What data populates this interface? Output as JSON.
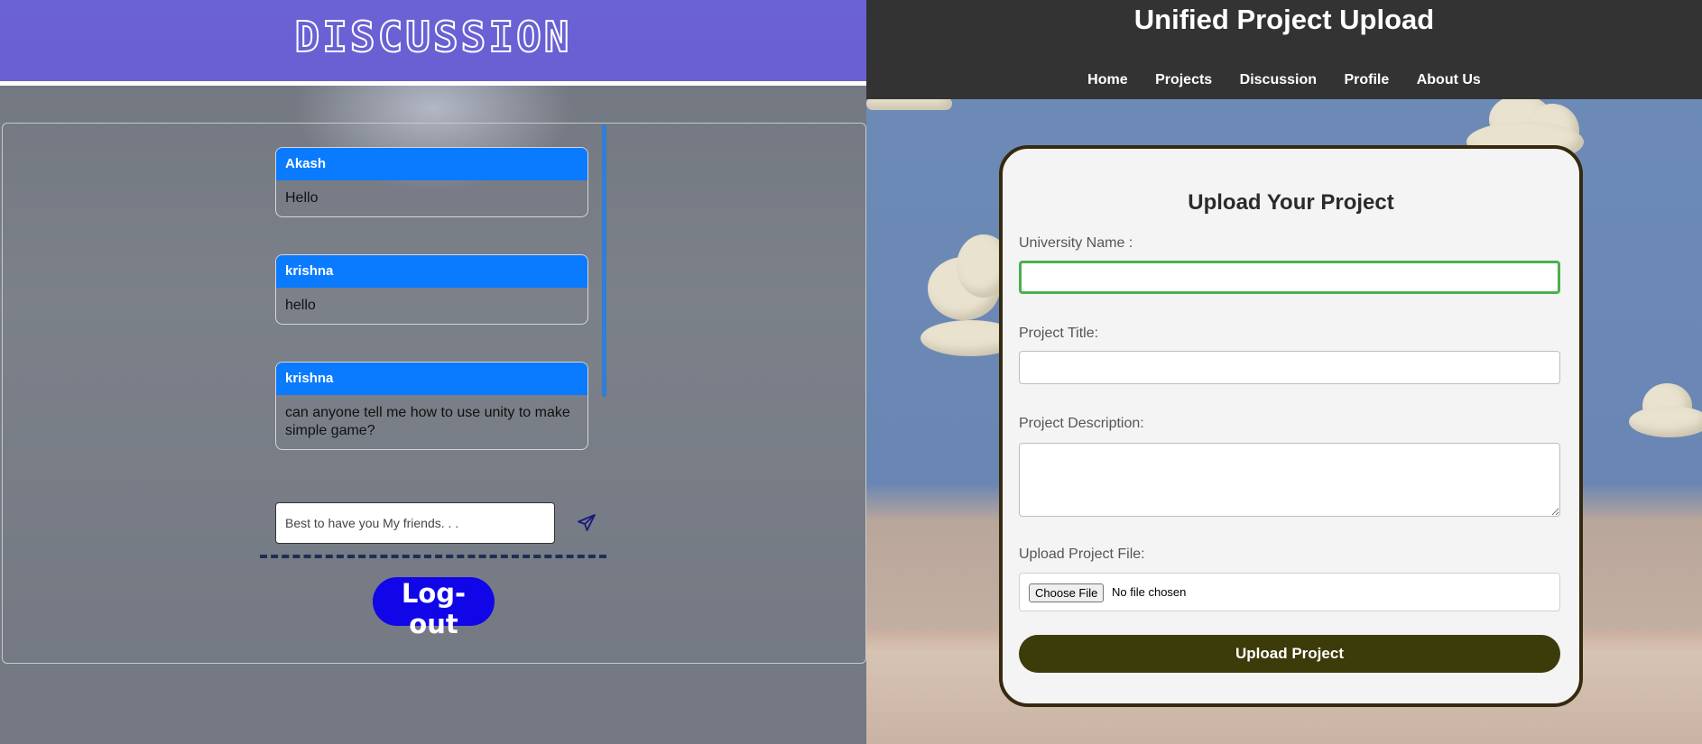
{
  "discussion": {
    "title": "DISCUSSION",
    "messages": [
      {
        "author": "Akash",
        "text": "Hello"
      },
      {
        "author": "krishna",
        "text": "hello"
      },
      {
        "author": "krishna",
        "text": "can anyone tell me how to use unity to make simple game?"
      }
    ],
    "compose_value": "Best to have you My friends. . .",
    "logout_label": "Log-out",
    "send_icon": "paper-plane-icon",
    "colors": {
      "header": "#6a5fd3",
      "message_header": "#0a7bff",
      "logout": "#1106e8"
    }
  },
  "upload": {
    "app_title": "Unified Project Upload",
    "nav": [
      "Home",
      "Projects",
      "Discussion",
      "Profile",
      "About Us"
    ],
    "form_title": "Upload Your Project",
    "labels": {
      "university": "University Name :",
      "title": "Project Title:",
      "description": "Project Description:",
      "file": "Upload Project File:"
    },
    "values": {
      "university": "",
      "title": "",
      "description": ""
    },
    "choose_file_label": "Choose File",
    "file_status": "No file chosen",
    "submit_label": "Upload Project",
    "colors": {
      "topbar": "#333333",
      "focus": "#4caf50",
      "submit": "#3c3b0a",
      "card_border": "#352a10"
    }
  }
}
